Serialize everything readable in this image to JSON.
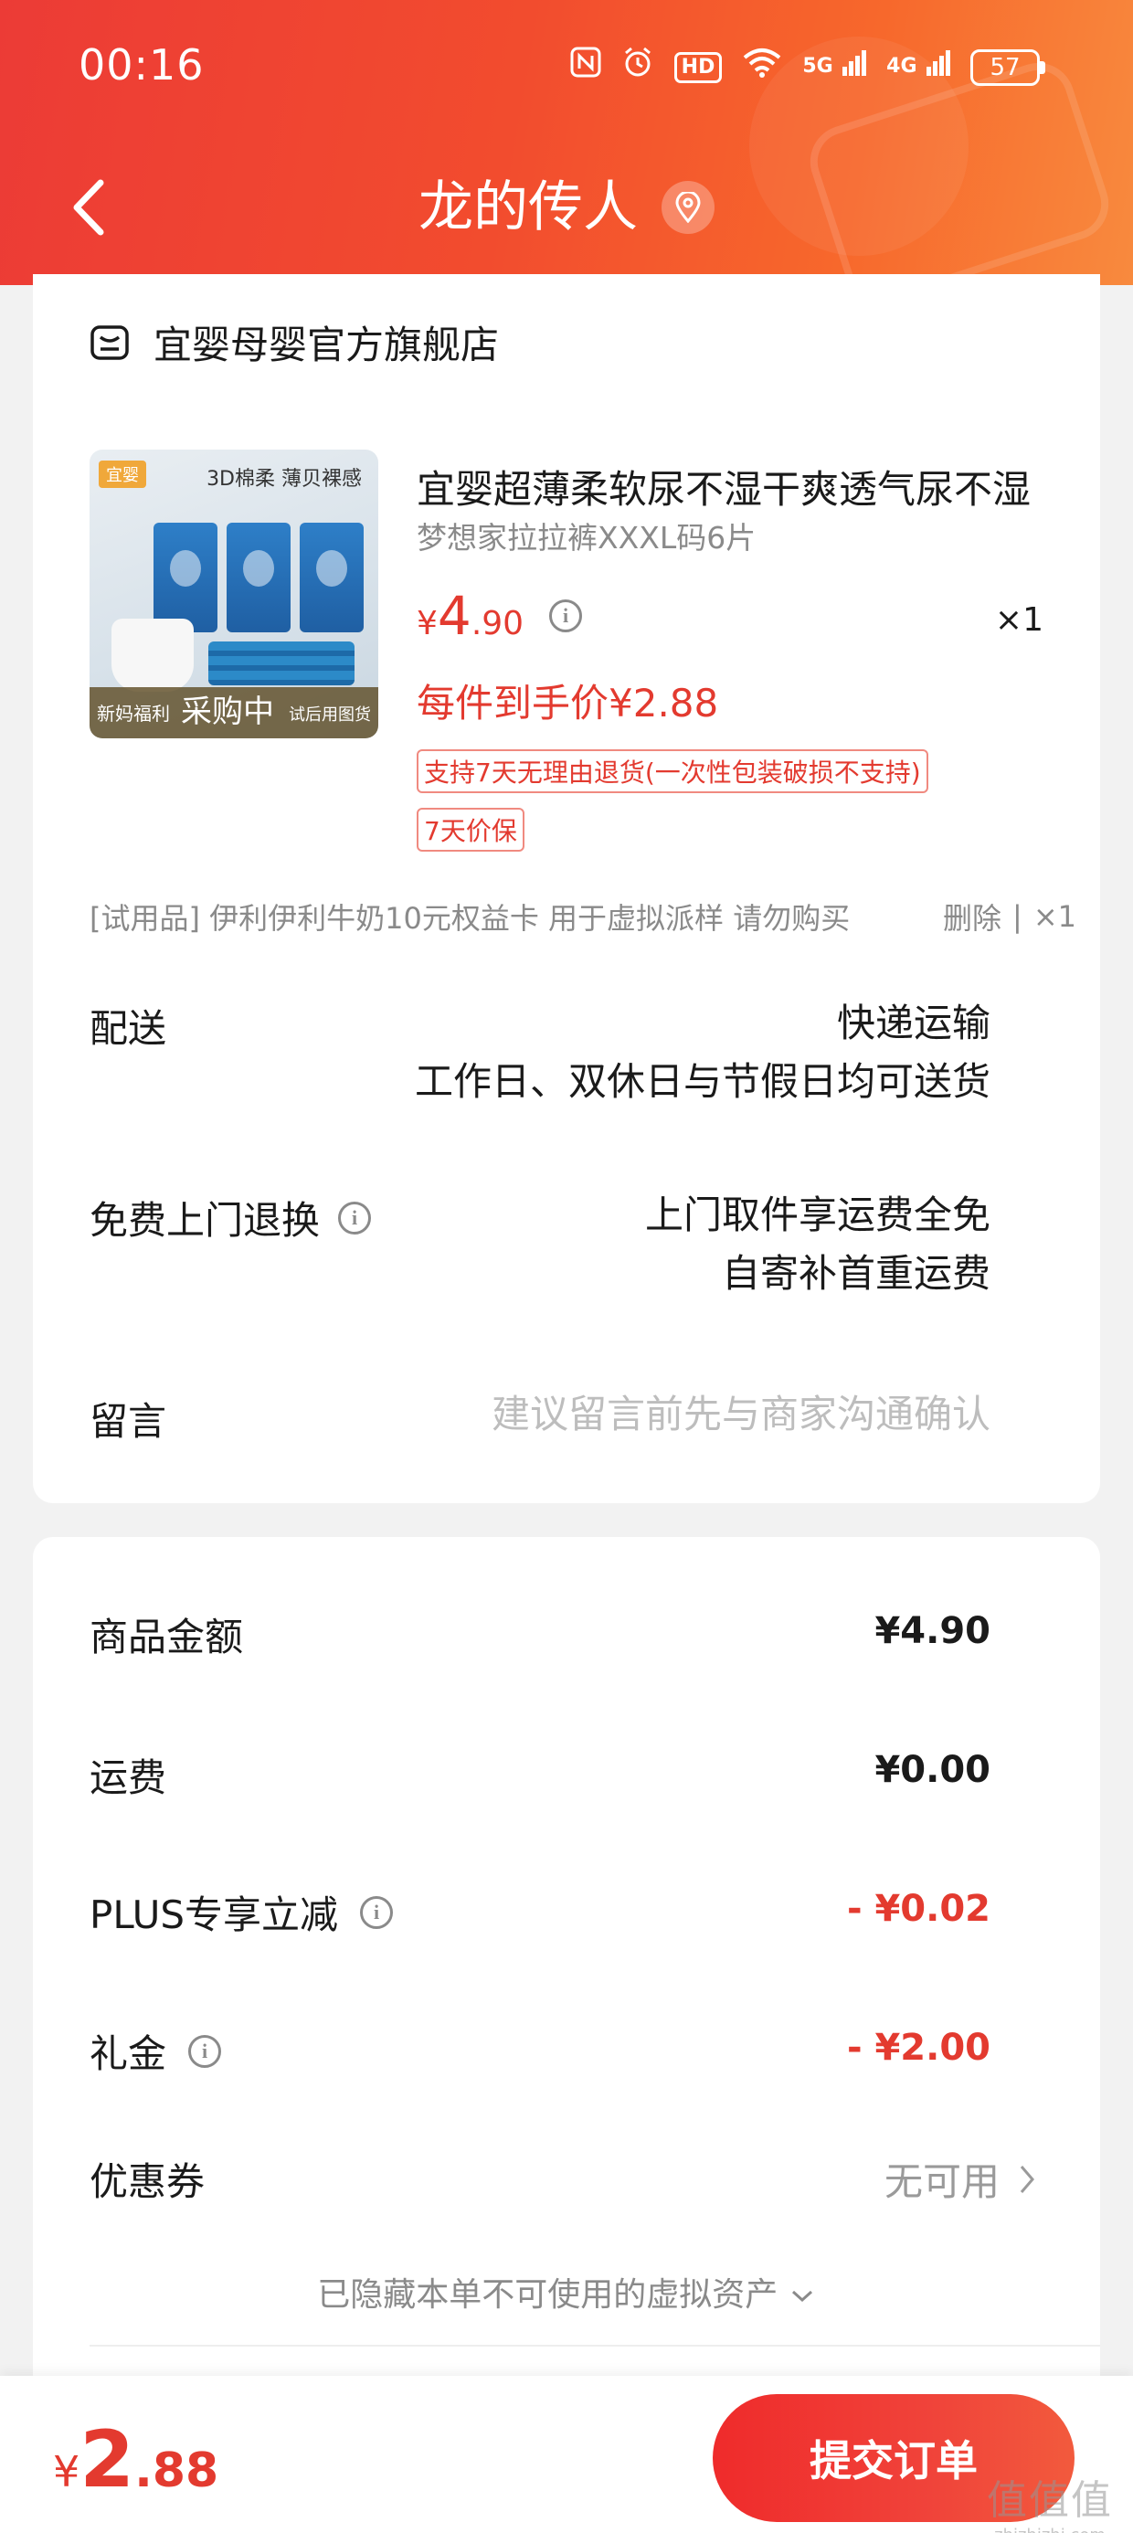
{
  "status_bar": {
    "time": "00:16",
    "hd_label": "HD",
    "net1": "5G",
    "net2": "4G",
    "battery": "57"
  },
  "nav": {
    "title": "龙的传人"
  },
  "store": {
    "name": "宜婴母婴官方旗舰店"
  },
  "product": {
    "image_tag": "宜婴",
    "image_headline": "3D棉柔 薄贝裸感",
    "image_banner_left": "新妈福利",
    "image_banner_center": "采购中",
    "image_banner_right": "试后用图货",
    "title": "宜婴超薄柔软尿不湿干爽透气尿不湿",
    "spec": "梦想家拉拉裤XXXL码6片",
    "price_currency": "¥",
    "price_int": "4",
    "price_dec": ".90",
    "quantity": "×1",
    "net_price": "每件到手价¥2.88",
    "tags": [
      "支持7天无理由退货(一次性包装破损不支持)",
      "7天价保"
    ]
  },
  "trial": {
    "text": "[试用品]  伊利伊利牛奶10元权益卡 用于虚拟派样 请勿购买",
    "delete": "删除",
    "sep": "|",
    "qty": "×1"
  },
  "delivery": {
    "label": "配送",
    "line1": "快递运输",
    "line2": "工作日、双休日与节假日均可送货"
  },
  "returns": {
    "label": "免费上门退换",
    "line1": "上门取件享运费全免",
    "line2": "自寄补首重运费"
  },
  "message": {
    "label": "留言",
    "placeholder": "建议留言前先与商家沟通确认"
  },
  "summary": {
    "goods_label": "商品金额",
    "goods_value": "¥4.90",
    "shipping_label": "运费",
    "shipping_value": "¥0.00",
    "plus_label": "PLUS专享立减",
    "plus_value": "- ¥0.02",
    "gift_label": "礼金",
    "gift_value": "- ¥2.00",
    "coupon_label": "优惠券",
    "coupon_value": "无可用",
    "hidden_note": "已隐藏本单不可使用的虚拟资产"
  },
  "footer": {
    "total_currency": "¥",
    "total_int": "2",
    "total_dec": ".88",
    "submit_label": "提交订单"
  },
  "watermark": {
    "main": "值值值",
    "sub": "zhizhizhi.com"
  },
  "colors": {
    "accent": "#e33a2f",
    "header_start": "#ec3b36",
    "header_end": "#f88a3e"
  }
}
